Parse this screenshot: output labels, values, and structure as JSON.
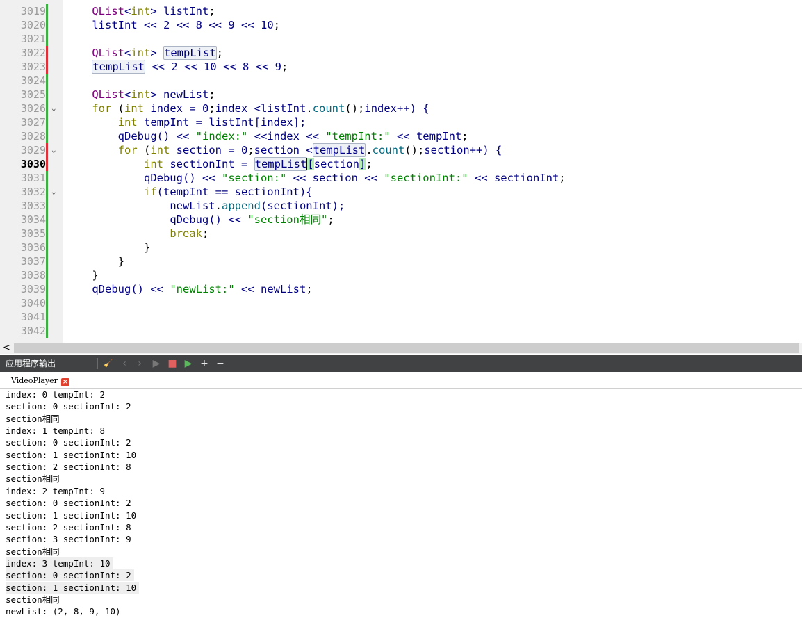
{
  "editor": {
    "lines": [
      {
        "num": "3019",
        "mark": "green",
        "fold": false,
        "current": false,
        "tokens": [
          [
            "    ",
            "pl"
          ],
          [
            "QList",
            "ty"
          ],
          [
            "<",
            "nm"
          ],
          [
            "int",
            "kw"
          ],
          [
            "> ",
            "nm"
          ],
          [
            "listInt",
            "nm"
          ],
          [
            ";",
            "pl"
          ]
        ]
      },
      {
        "num": "3020",
        "mark": "green",
        "fold": false,
        "current": false,
        "tokens": [
          [
            "    ",
            "pl"
          ],
          [
            "listInt",
            "nm"
          ],
          [
            " << ",
            "nm"
          ],
          [
            "2",
            "nm"
          ],
          [
            " << ",
            "nm"
          ],
          [
            "8",
            "nm"
          ],
          [
            " << ",
            "nm"
          ],
          [
            "9",
            "nm"
          ],
          [
            " << ",
            "nm"
          ],
          [
            "10",
            "nm"
          ],
          [
            ";",
            "pl"
          ]
        ]
      },
      {
        "num": "3021",
        "mark": "green",
        "fold": false,
        "current": false,
        "tokens": []
      },
      {
        "num": "3022",
        "mark": "red",
        "fold": false,
        "current": false,
        "tokens": [
          [
            "    ",
            "pl"
          ],
          [
            "QList",
            "ty"
          ],
          [
            "<",
            "nm"
          ],
          [
            "int",
            "kw"
          ],
          [
            "> ",
            "nm"
          ],
          [
            "tempList",
            "nm",
            "hl"
          ],
          [
            ";",
            "pl"
          ]
        ]
      },
      {
        "num": "3023",
        "mark": "red",
        "fold": false,
        "current": false,
        "tokens": [
          [
            "    ",
            "pl"
          ],
          [
            "tempList",
            "nm",
            "hl"
          ],
          [
            " << ",
            "nm"
          ],
          [
            "2",
            "nm"
          ],
          [
            " << ",
            "nm"
          ],
          [
            "10",
            "nm"
          ],
          [
            " << ",
            "nm"
          ],
          [
            "8",
            "nm"
          ],
          [
            " << ",
            "nm"
          ],
          [
            "9",
            "nm"
          ],
          [
            ";",
            "pl"
          ]
        ]
      },
      {
        "num": "3024",
        "mark": "green",
        "fold": false,
        "current": false,
        "tokens": []
      },
      {
        "num": "3025",
        "mark": "green",
        "fold": false,
        "current": false,
        "tokens": [
          [
            "    ",
            "pl"
          ],
          [
            "QList",
            "ty"
          ],
          [
            "<",
            "nm"
          ],
          [
            "int",
            "kw"
          ],
          [
            "> ",
            "nm"
          ],
          [
            "newList",
            "nm"
          ],
          [
            ";",
            "pl"
          ]
        ]
      },
      {
        "num": "3026",
        "mark": "green",
        "fold": true,
        "current": false,
        "tokens": [
          [
            "    ",
            "pl"
          ],
          [
            "for",
            "kw"
          ],
          [
            " (",
            "pl"
          ],
          [
            "int",
            "kw"
          ],
          [
            " index = ",
            "nm"
          ],
          [
            "0",
            "nm"
          ],
          [
            ";",
            "pl"
          ],
          [
            "index <",
            "nm"
          ],
          [
            "listInt",
            "nm"
          ],
          [
            ".",
            "pl"
          ],
          [
            "count",
            "fn"
          ],
          [
            "();",
            "pl"
          ],
          [
            "index++) {",
            "nm"
          ]
        ]
      },
      {
        "num": "3027",
        "mark": "green",
        "fold": false,
        "current": false,
        "tokens": [
          [
            "        ",
            "pl"
          ],
          [
            "int",
            "kw"
          ],
          [
            " tempInt = ",
            "nm"
          ],
          [
            "listInt",
            "nm"
          ],
          [
            "[index];",
            "nm"
          ]
        ]
      },
      {
        "num": "3028",
        "mark": "green",
        "fold": false,
        "current": false,
        "tokens": [
          [
            "        ",
            "pl"
          ],
          [
            "qDebug",
            "nm"
          ],
          [
            "() << ",
            "nm"
          ],
          [
            "\"index:\"",
            "st"
          ],
          [
            " <<",
            "nm"
          ],
          [
            "index << ",
            "nm"
          ],
          [
            "\"tempInt:\"",
            "st"
          ],
          [
            " << ",
            "nm"
          ],
          [
            "tempInt",
            "nm"
          ],
          [
            ";",
            "pl"
          ]
        ]
      },
      {
        "num": "3029",
        "mark": "red",
        "fold": true,
        "current": false,
        "tokens": [
          [
            "        ",
            "pl"
          ],
          [
            "for",
            "kw"
          ],
          [
            " (",
            "pl"
          ],
          [
            "int",
            "kw"
          ],
          [
            " section = ",
            "nm"
          ],
          [
            "0",
            "nm"
          ],
          [
            ";",
            "pl"
          ],
          [
            "section <",
            "nm"
          ],
          [
            "tempList",
            "nm",
            "hl"
          ],
          [
            ".",
            "pl"
          ],
          [
            "count",
            "fn"
          ],
          [
            "();",
            "pl"
          ],
          [
            "section++) {",
            "nm"
          ]
        ]
      },
      {
        "num": "3030",
        "mark": "red",
        "fold": false,
        "current": true,
        "tokens": [
          [
            "            ",
            "pl"
          ],
          [
            "int",
            "kw"
          ],
          [
            " sectionInt = ",
            "nm"
          ],
          [
            "tempList",
            "nm",
            "hl"
          ],
          [
            "|",
            "cur"
          ],
          [
            "[",
            "nm",
            "mt"
          ],
          [
            "section",
            "nm"
          ],
          [
            "]",
            "nm",
            "mt"
          ],
          [
            ";",
            "pl"
          ]
        ]
      },
      {
        "num": "3031",
        "mark": "green",
        "fold": false,
        "current": false,
        "tokens": [
          [
            "            ",
            "pl"
          ],
          [
            "qDebug",
            "nm"
          ],
          [
            "() << ",
            "nm"
          ],
          [
            "\"section:\"",
            "st"
          ],
          [
            " << ",
            "nm"
          ],
          [
            "section << ",
            "nm"
          ],
          [
            "\"sectionInt:\"",
            "st"
          ],
          [
            " << ",
            "nm"
          ],
          [
            "sectionInt",
            "nm"
          ],
          [
            ";",
            "pl"
          ]
        ]
      },
      {
        "num": "3032",
        "mark": "green",
        "fold": true,
        "current": false,
        "tokens": [
          [
            "            ",
            "pl"
          ],
          [
            "if",
            "kw"
          ],
          [
            "(tempInt == sectionInt){",
            "nm"
          ]
        ]
      },
      {
        "num": "3033",
        "mark": "green",
        "fold": false,
        "current": false,
        "tokens": [
          [
            "                ",
            "pl"
          ],
          [
            "newList",
            "nm"
          ],
          [
            ".",
            "pl"
          ],
          [
            "append",
            "fn"
          ],
          [
            "(sectionInt);",
            "nm"
          ]
        ]
      },
      {
        "num": "3034",
        "mark": "green",
        "fold": false,
        "current": false,
        "tokens": [
          [
            "                ",
            "pl"
          ],
          [
            "qDebug",
            "nm"
          ],
          [
            "() << ",
            "nm"
          ],
          [
            "\"section相同\"",
            "st"
          ],
          [
            ";",
            "pl"
          ]
        ]
      },
      {
        "num": "3035",
        "mark": "green",
        "fold": false,
        "current": false,
        "tokens": [
          [
            "                ",
            "pl"
          ],
          [
            "break",
            "kw"
          ],
          [
            ";",
            "pl"
          ]
        ]
      },
      {
        "num": "3036",
        "mark": "green",
        "fold": false,
        "current": false,
        "tokens": [
          [
            "            ",
            "pl"
          ],
          [
            "}",
            "pl"
          ]
        ]
      },
      {
        "num": "3037",
        "mark": "green",
        "fold": false,
        "current": false,
        "tokens": [
          [
            "        ",
            "pl"
          ],
          [
            "}",
            "pl"
          ]
        ]
      },
      {
        "num": "3038",
        "mark": "green",
        "fold": false,
        "current": false,
        "tokens": [
          [
            "    ",
            "pl"
          ],
          [
            "}",
            "pl"
          ]
        ]
      },
      {
        "num": "3039",
        "mark": "green",
        "fold": false,
        "current": false,
        "tokens": [
          [
            "    ",
            "pl"
          ],
          [
            "qDebug",
            "nm"
          ],
          [
            "() << ",
            "nm"
          ],
          [
            "\"newList:\"",
            "st"
          ],
          [
            " << ",
            "nm"
          ],
          [
            "newList",
            "nm"
          ],
          [
            ";",
            "pl"
          ]
        ]
      },
      {
        "num": "3040",
        "mark": "green",
        "fold": false,
        "current": false,
        "tokens": []
      },
      {
        "num": "3041",
        "mark": "green",
        "fold": false,
        "current": false,
        "tokens": []
      },
      {
        "num": "3042",
        "mark": "green",
        "fold": false,
        "current": false,
        "tokens": []
      }
    ]
  },
  "scrollbar": {
    "left_arrow": "<"
  },
  "pane": {
    "title": "应用程序输出",
    "buttons": [
      {
        "name": "clear-icon",
        "glyph": "🧹",
        "color": "#d8d8d8",
        "enabled": true
      },
      {
        "name": "previous-icon",
        "glyph": "‹",
        "color": "#777777",
        "enabled": false
      },
      {
        "name": "next-icon",
        "glyph": "›",
        "color": "#777777",
        "enabled": false
      },
      {
        "name": "run-icon",
        "glyph": "▶",
        "color": "#777777",
        "enabled": false
      },
      {
        "name": "stop-icon",
        "glyph": "■",
        "color": "#e06060",
        "enabled": true
      },
      {
        "name": "attach-debugger-icon",
        "glyph": "▶",
        "color": "#5cb85c",
        "enabled": true
      },
      {
        "name": "zoom-in-icon",
        "glyph": "+",
        "color": "#e8e8e8",
        "enabled": true
      },
      {
        "name": "zoom-out-icon",
        "glyph": "−",
        "color": "#e8e8e8",
        "enabled": true
      }
    ],
    "tab": {
      "label": "VideoPlayer",
      "close_glyph": "×"
    }
  },
  "output": {
    "lines": [
      "index: 0 tempInt: 2",
      "section: 0 sectionInt: 2",
      "section相同",
      "index: 1 tempInt: 8",
      "section: 0 sectionInt: 2",
      "section: 1 sectionInt: 10",
      "section: 2 sectionInt: 8",
      "section相同",
      "index: 2 tempInt: 9",
      "section: 0 sectionInt: 2",
      "section: 1 sectionInt: 10",
      "section: 2 sectionInt: 8",
      "section: 3 sectionInt: 9",
      "section相同",
      "index: 3 tempInt: 10",
      "section: 0 sectionInt: 2",
      "section: 1 sectionInt: 10",
      "section相同",
      "newList: (2, 8, 9, 10)"
    ],
    "selected_lines": [
      14,
      15,
      16
    ]
  },
  "colors": {
    "mark_green": "#3cb043",
    "mark_red": "#e0303a"
  }
}
